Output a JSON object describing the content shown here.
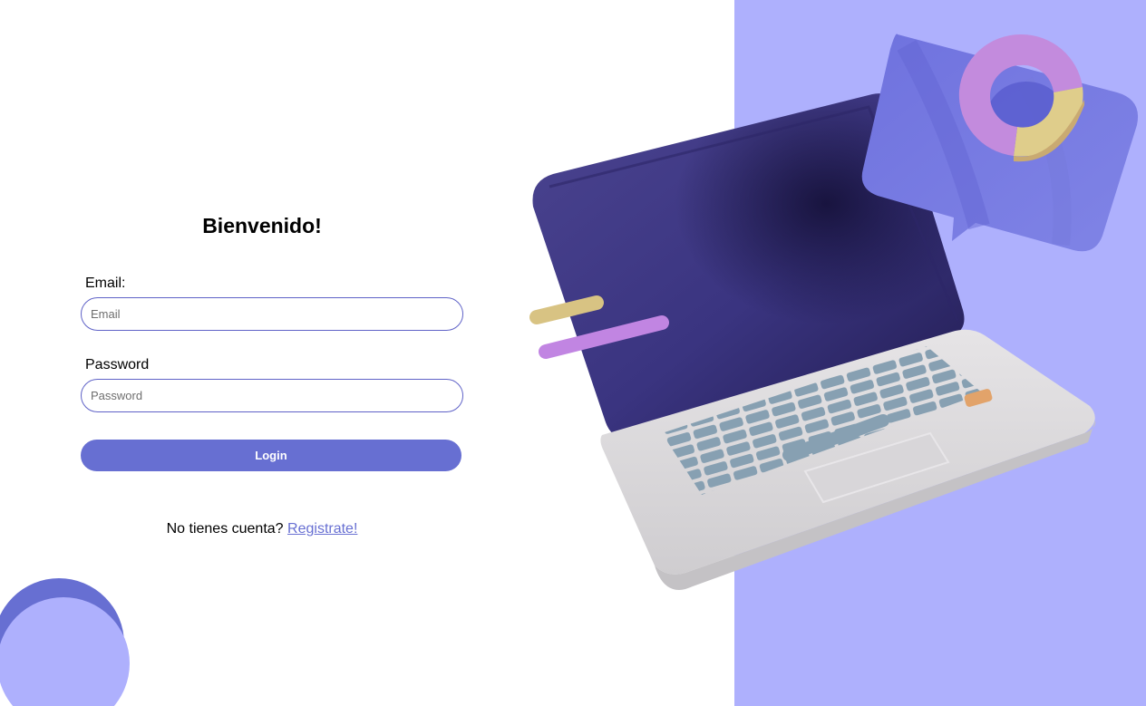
{
  "colors": {
    "accent": "#676fd2",
    "panel_background": "#aeb0fd",
    "input_border": "#5f62c7"
  },
  "login_form": {
    "title": "Bienvenido!",
    "email_label": "Email:",
    "email_placeholder": "Email",
    "email_value": "",
    "password_label": "Password",
    "password_placeholder": "Password",
    "password_value": "",
    "login_button": "Login",
    "register_prompt": "No tienes cuenta?",
    "register_link": "Registrate!"
  },
  "illustration": {
    "name": "laptop-with-chart-illustration"
  }
}
